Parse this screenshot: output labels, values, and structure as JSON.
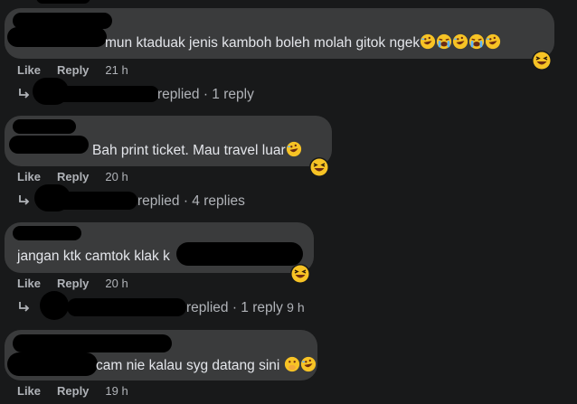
{
  "comments": [
    {
      "text": "mun ktaduak jenis kamboh boleh molah gitok ngek",
      "emoji_inline": [
        "rofl-emoji",
        "crying-emoji",
        "rofl-emoji",
        "crying-emoji",
        "rofl-emoji"
      ],
      "reaction": "haha-reaction",
      "actions": {
        "like": "Like",
        "reply": "Reply",
        "time": "21 h"
      },
      "replies": {
        "text": "replied · 1 reply",
        "time": ""
      }
    },
    {
      "text": "Bah print ticket. Mau travel luar",
      "emoji_inline": [
        "rofl-emoji"
      ],
      "reaction": "haha-reaction",
      "actions": {
        "like": "Like",
        "reply": "Reply",
        "time": "20 h"
      },
      "replies": {
        "text": "replied · 4 replies",
        "time": ""
      }
    },
    {
      "text": "jangan ktk camtok klak k",
      "emoji_inline": [],
      "reaction": "haha-reaction",
      "actions": {
        "like": "Like",
        "reply": "Reply",
        "time": "20 h"
      },
      "replies": {
        "text": "replied · 1 reply",
        "time": "9 h"
      }
    },
    {
      "text": "cam nie kalau syg datang sini",
      "emoji_inline": [
        "hand-over-mouth-emoji",
        "rofl-emoji"
      ],
      "reaction": "",
      "actions": {
        "like": "Like",
        "reply": "Reply",
        "time": "19 h"
      },
      "replies": null
    }
  ]
}
